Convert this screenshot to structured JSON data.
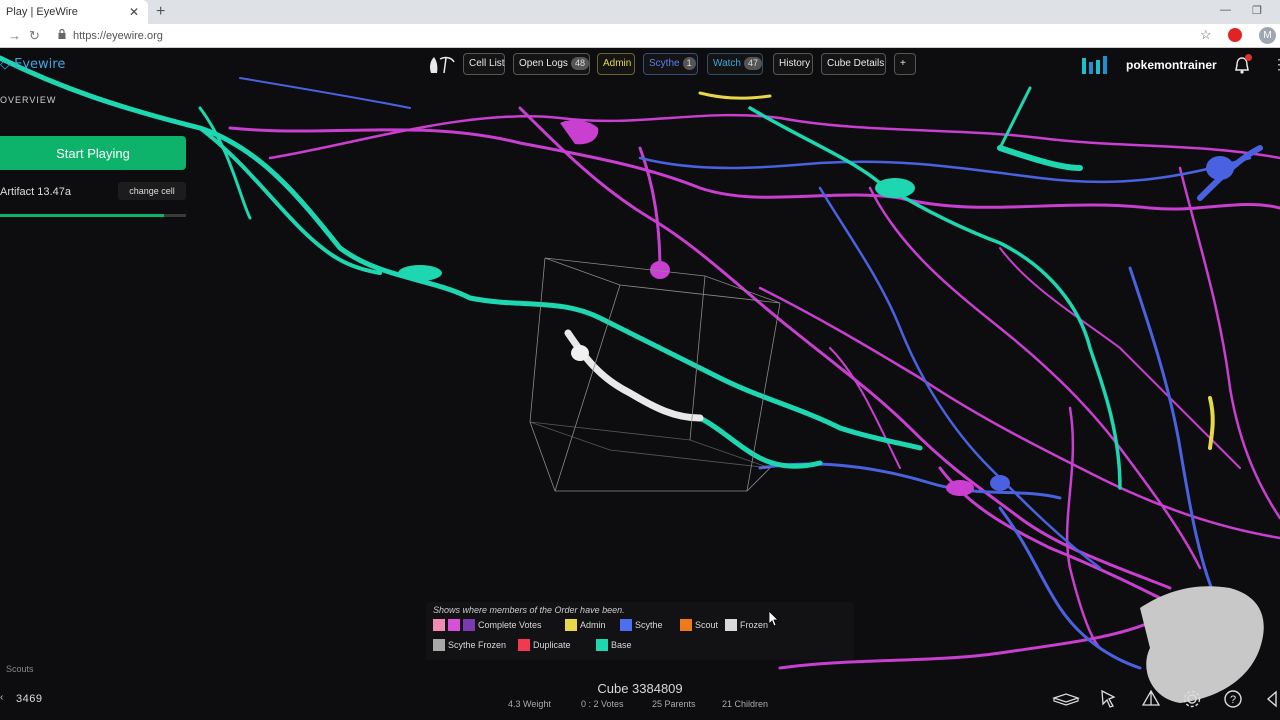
{
  "browser": {
    "tab_title": "Play | EyeWire",
    "tab_close": "✕",
    "new_tab": "+",
    "url": "https://eyewire.org",
    "avatar_letter": "M",
    "minimize": "—",
    "restore": "❐"
  },
  "app": {
    "logo": "Eyewire",
    "overview_label": "OVERVIEW",
    "start_button": "Start Playing",
    "artifact_label": "Artifact 13.47a",
    "change_cell_button": "change cell",
    "progress_fraction": 0.88,
    "accent_green": "#0db36b"
  },
  "toolbar": {
    "buttons": [
      {
        "label": "Cell List"
      },
      {
        "label": "Open Logs",
        "badge": "48"
      },
      {
        "label": "Admin"
      },
      {
        "label": "Scythe",
        "badge": "1"
      },
      {
        "label": "Watch",
        "badge": "47"
      },
      {
        "label": "History"
      },
      {
        "label": "Cube Details"
      },
      {
        "label": "+"
      }
    ]
  },
  "user": {
    "username": "pokemontrainer"
  },
  "legend": {
    "title": "Shows where members of the Order have been.",
    "items": [
      {
        "label": "Complete Votes",
        "colors": [
          "#f08cb4",
          "#d84fd8",
          "#7a3ab0"
        ]
      },
      {
        "label": "Admin",
        "colors": [
          "#e6d84a"
        ]
      },
      {
        "label": "Scythe",
        "colors": [
          "#4f6ef0"
        ]
      },
      {
        "label": "Scout",
        "colors": [
          "#f07a1a"
        ]
      },
      {
        "label": "Frozen",
        "colors": [
          "#d8d8d8"
        ]
      },
      {
        "label": "Scythe Frozen",
        "colors": [
          "#a8a8a8"
        ]
      },
      {
        "label": "Duplicate",
        "colors": [
          "#f03a50"
        ]
      },
      {
        "label": "Base",
        "colors": [
          "#1ed6b0"
        ]
      }
    ]
  },
  "bottom": {
    "scouts_label": "Scouts",
    "count": "3469",
    "cube_title": "Cube 3384809",
    "stats": {
      "weight": "4.3 Weight",
      "votes": "0 : 2 Votes",
      "parents": "25 Parents",
      "children": "21 Children"
    }
  }
}
